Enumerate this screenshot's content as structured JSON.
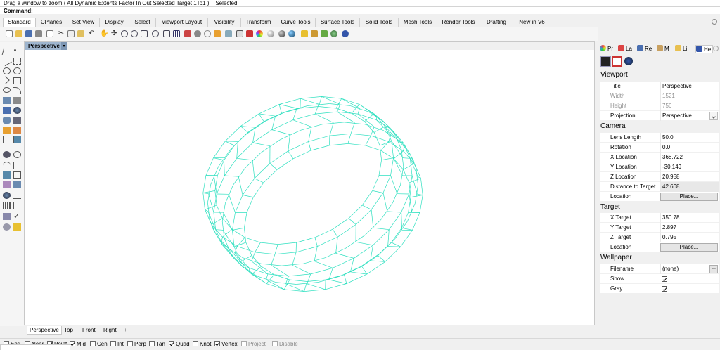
{
  "command": {
    "history": "Drag a window to zoom ( All  Dynamic  Extents  Factor  In  Out  Selected  Target  1To1 ): _Selected",
    "prompt": "Command:"
  },
  "tabs": [
    "Standard",
    "CPlanes",
    "Set View",
    "Display",
    "Select",
    "Viewport Layout",
    "Visibility",
    "Transform",
    "Curve Tools",
    "Surface Tools",
    "Solid Tools",
    "Mesh Tools",
    "Render Tools",
    "Drafting",
    "New in V6"
  ],
  "viewport": {
    "title": "Perspective",
    "wire_color": "#2fe0c0",
    "bottom_tabs": [
      "Perspective",
      "Top",
      "Front",
      "Right"
    ],
    "add_tab": "+"
  },
  "osnaps": [
    {
      "label": "End",
      "checked": false
    },
    {
      "label": "Near",
      "checked": false
    },
    {
      "label": "Point",
      "checked": true
    },
    {
      "label": "Mid",
      "checked": true
    },
    {
      "label": "Cen",
      "checked": false
    },
    {
      "label": "Int",
      "checked": false
    },
    {
      "label": "Perp",
      "checked": false
    },
    {
      "label": "Tan",
      "checked": false
    },
    {
      "label": "Quad",
      "checked": true
    },
    {
      "label": "Knot",
      "checked": false
    },
    {
      "label": "Vertex",
      "checked": true
    },
    {
      "label": "Project",
      "checked": false,
      "disabled": true
    },
    {
      "label": "Disable",
      "checked": false,
      "disabled": true
    }
  ],
  "panel": {
    "tabs": [
      "Pr",
      "La",
      "Re",
      "M",
      "Li",
      "He"
    ],
    "viewport_section": "Viewport",
    "title_label": "Title",
    "title_value": "Perspective",
    "width_label": "Width",
    "width_value": "1521",
    "height_label": "Height",
    "height_value": "756",
    "projection_label": "Projection",
    "projection_value": "Perspective",
    "camera_section": "Camera",
    "lens_label": "Lens Length",
    "lens_value": "50.0",
    "rotation_label": "Rotation",
    "rotation_value": "0.0",
    "xloc_label": "X Location",
    "xloc_value": "368.722",
    "yloc_label": "Y Location",
    "yloc_value": "-30.149",
    "zloc_label": "Z Location",
    "zloc_value": "20.958",
    "dist_label": "Distance to Target",
    "dist_value": "42.668",
    "location_label": "Location",
    "place_button": "Place...",
    "target_section": "Target",
    "xt_label": "X Target",
    "xt_value": "350.78",
    "yt_label": "Y Target",
    "yt_value": "2.897",
    "zt_label": "Z Target",
    "zt_value": "0.795",
    "tlocation_label": "Location",
    "tplace_button": "Place...",
    "wallpaper_section": "Wallpaper",
    "filename_label": "Filename",
    "filename_value": "(none)",
    "browse_button": "...",
    "show_label": "Show",
    "show_checked": true,
    "gray_label": "Gray",
    "gray_checked": true
  }
}
